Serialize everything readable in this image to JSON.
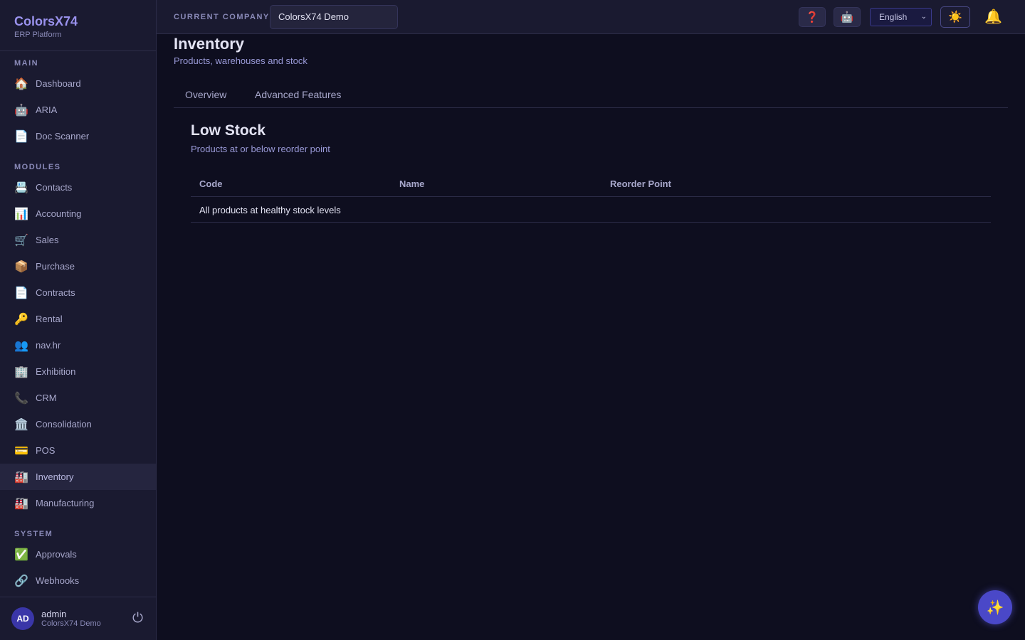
{
  "brand": {
    "title": "ColorsX74",
    "subtitle": "ERP Platform"
  },
  "sidebar": {
    "main_label": "MAIN",
    "main_items": [
      {
        "label": "Dashboard",
        "icon": "🏠"
      },
      {
        "label": "ARIA",
        "icon": "🤖"
      },
      {
        "label": "Doc Scanner",
        "icon": "📄"
      }
    ],
    "modules_label": "MODULES",
    "modules_items": [
      {
        "label": "Contacts",
        "icon": "📇"
      },
      {
        "label": "Accounting",
        "icon": "📊"
      },
      {
        "label": "Sales",
        "icon": "🛒"
      },
      {
        "label": "Purchase",
        "icon": "📦"
      },
      {
        "label": "Contracts",
        "icon": "📄"
      },
      {
        "label": "Rental",
        "icon": "🔑"
      },
      {
        "label": "nav.hr",
        "icon": "👥"
      },
      {
        "label": "Exhibition",
        "icon": "🏢"
      },
      {
        "label": "CRM",
        "icon": "📞"
      },
      {
        "label": "Consolidation",
        "icon": "🏛️"
      },
      {
        "label": "POS",
        "icon": "💳"
      },
      {
        "label": "Inventory",
        "icon": "🏭"
      },
      {
        "label": "Manufacturing",
        "icon": "🏭"
      }
    ],
    "system_label": "SYSTEM",
    "system_items": [
      {
        "label": "Approvals",
        "icon": "✅"
      },
      {
        "label": "Webhooks",
        "icon": "🔗"
      }
    ],
    "active_item": "Inventory"
  },
  "user": {
    "initials": "AD",
    "name": "admin",
    "company": "ColorsX74 Demo",
    "logout_icon": "⏻"
  },
  "topbar": {
    "company_label": "CURRENT COMPANY",
    "company_value": "ColorsX74 Demo",
    "help_icon": "❓",
    "assistant_icon": "🤖",
    "language": "English",
    "language_caret": "⌄",
    "theme_icon": "☀️",
    "bell_icon": "🔔"
  },
  "page": {
    "title": "Inventory",
    "subtitle": "Products, warehouses and stock",
    "tabs": [
      "Overview",
      "Advanced Features"
    ]
  },
  "low_stock": {
    "title": "Low Stock",
    "subtitle": "Products at or below reorder point",
    "columns": [
      "Code",
      "Name",
      "Reorder Point"
    ],
    "empty_message": "All products at healthy stock levels"
  },
  "fab_icon": "✨",
  "colors": {
    "background": "#0e0e1f",
    "sidebar": "#1a1a30",
    "accent": "#4a48c8",
    "brand": "#9a92ee"
  }
}
